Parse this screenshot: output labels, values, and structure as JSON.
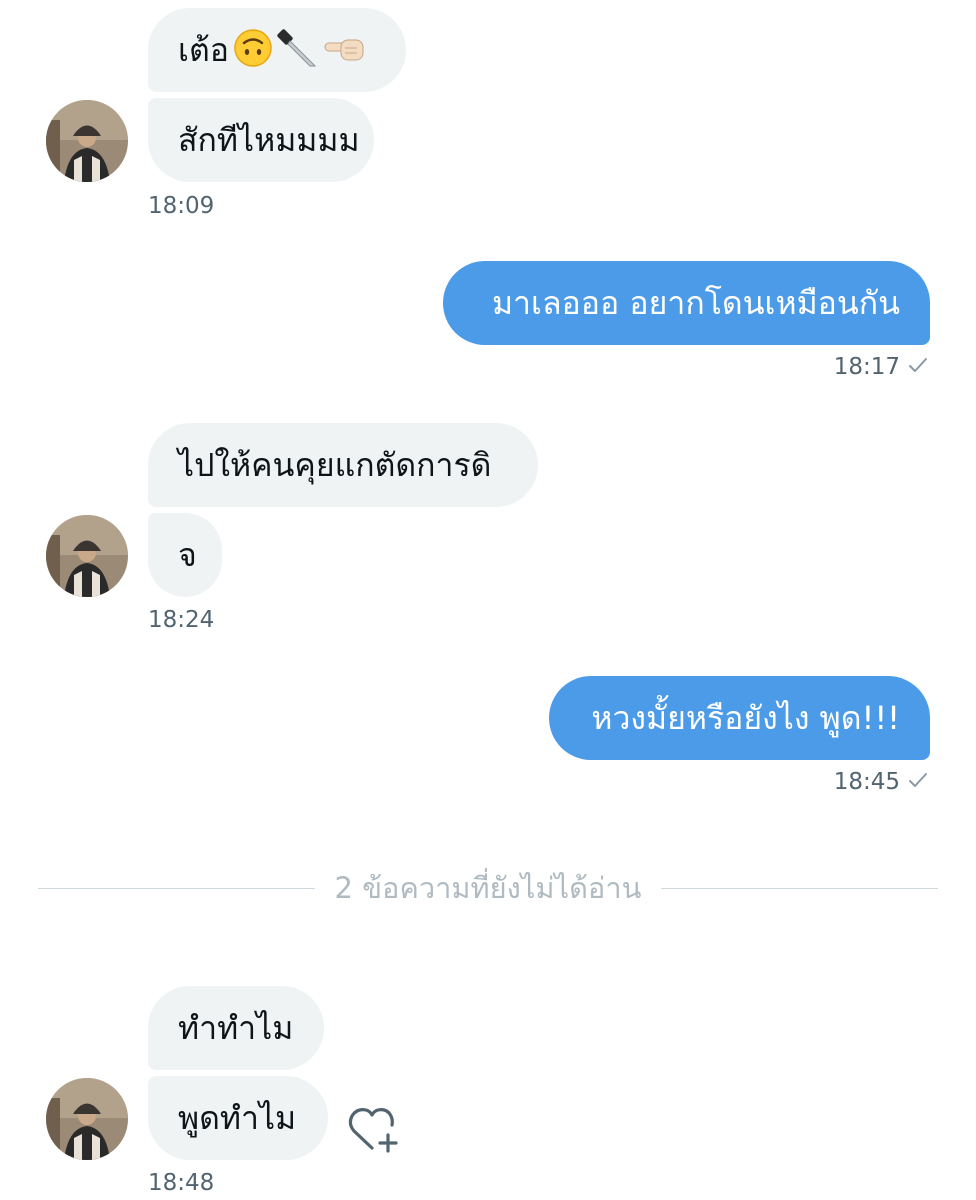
{
  "conversation": {
    "group1": {
      "message1": "เต้อ",
      "message2": "สักทีไหมมมม",
      "time": "18:09"
    },
    "sent1": {
      "message": "มาเลอออ อยากโดนเหมือนกัน",
      "time": "18:17"
    },
    "group2": {
      "message1": "ไปให้คนคุยแกตัดการดิ",
      "message2": "จ",
      "time": "18:24"
    },
    "sent2": {
      "message": "หวงมั้ยหรือยังไง พูด!!!",
      "time": "18:45"
    },
    "unread_divider": "2 ข้อความที่ยังไม่ได้อ่าน",
    "group3": {
      "message1": "ทำทำไม",
      "message2": "พูดทำไม",
      "time": "18:48"
    }
  },
  "icons": {
    "emoji_1": "upside-down-face-emoji",
    "emoji_2": "kitchen-knife-emoji",
    "emoji_3": "backhand-index-pointing-left-emoji",
    "read_check": "check-icon",
    "react": "heart-plus-icon"
  },
  "colors": {
    "sent_bubble": "#4c9be8",
    "received_bubble": "#eff3f4",
    "timestamp": "#536471",
    "divider_text": "#b0bac1"
  }
}
